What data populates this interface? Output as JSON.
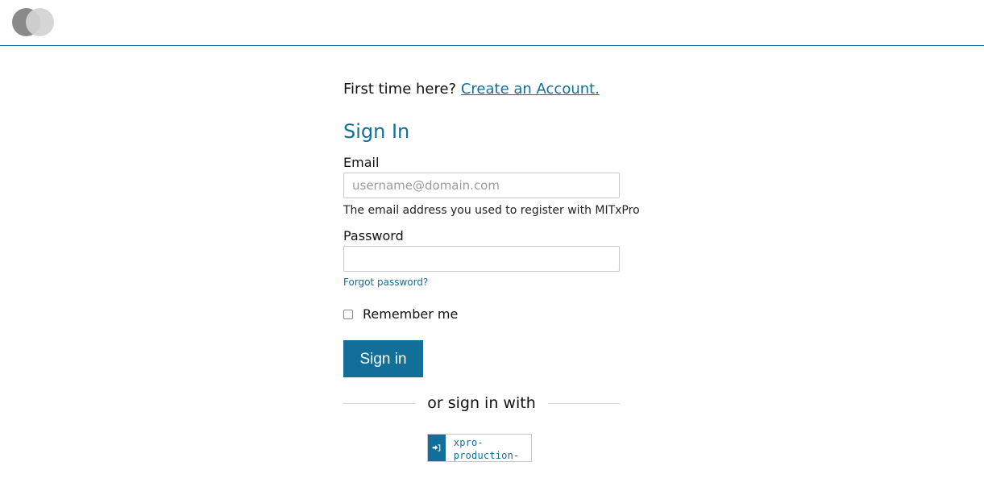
{
  "header": {
    "logo_icon": "logo-icon"
  },
  "page": {
    "first_time_text": "First time here?",
    "create_account_link": "Create an Account.",
    "title": "Sign In"
  },
  "form": {
    "email_label": "Email",
    "email_placeholder": "username@domain.com",
    "email_value": "",
    "email_help": "The email address you used to register with MITxPro",
    "password_label": "Password",
    "password_value": "",
    "forgot_password": "Forgot password?",
    "remember_me": "Remember me",
    "remember_checked": false,
    "signin_button": "Sign in"
  },
  "alt_signin": {
    "divider_text": "or sign in with",
    "providers": [
      {
        "label": "xpro-production-",
        "icon": "sign-in-icon"
      }
    ]
  },
  "colors": {
    "accent": "#126f9a",
    "header_border": "#1e6f94",
    "text": "#111111"
  }
}
